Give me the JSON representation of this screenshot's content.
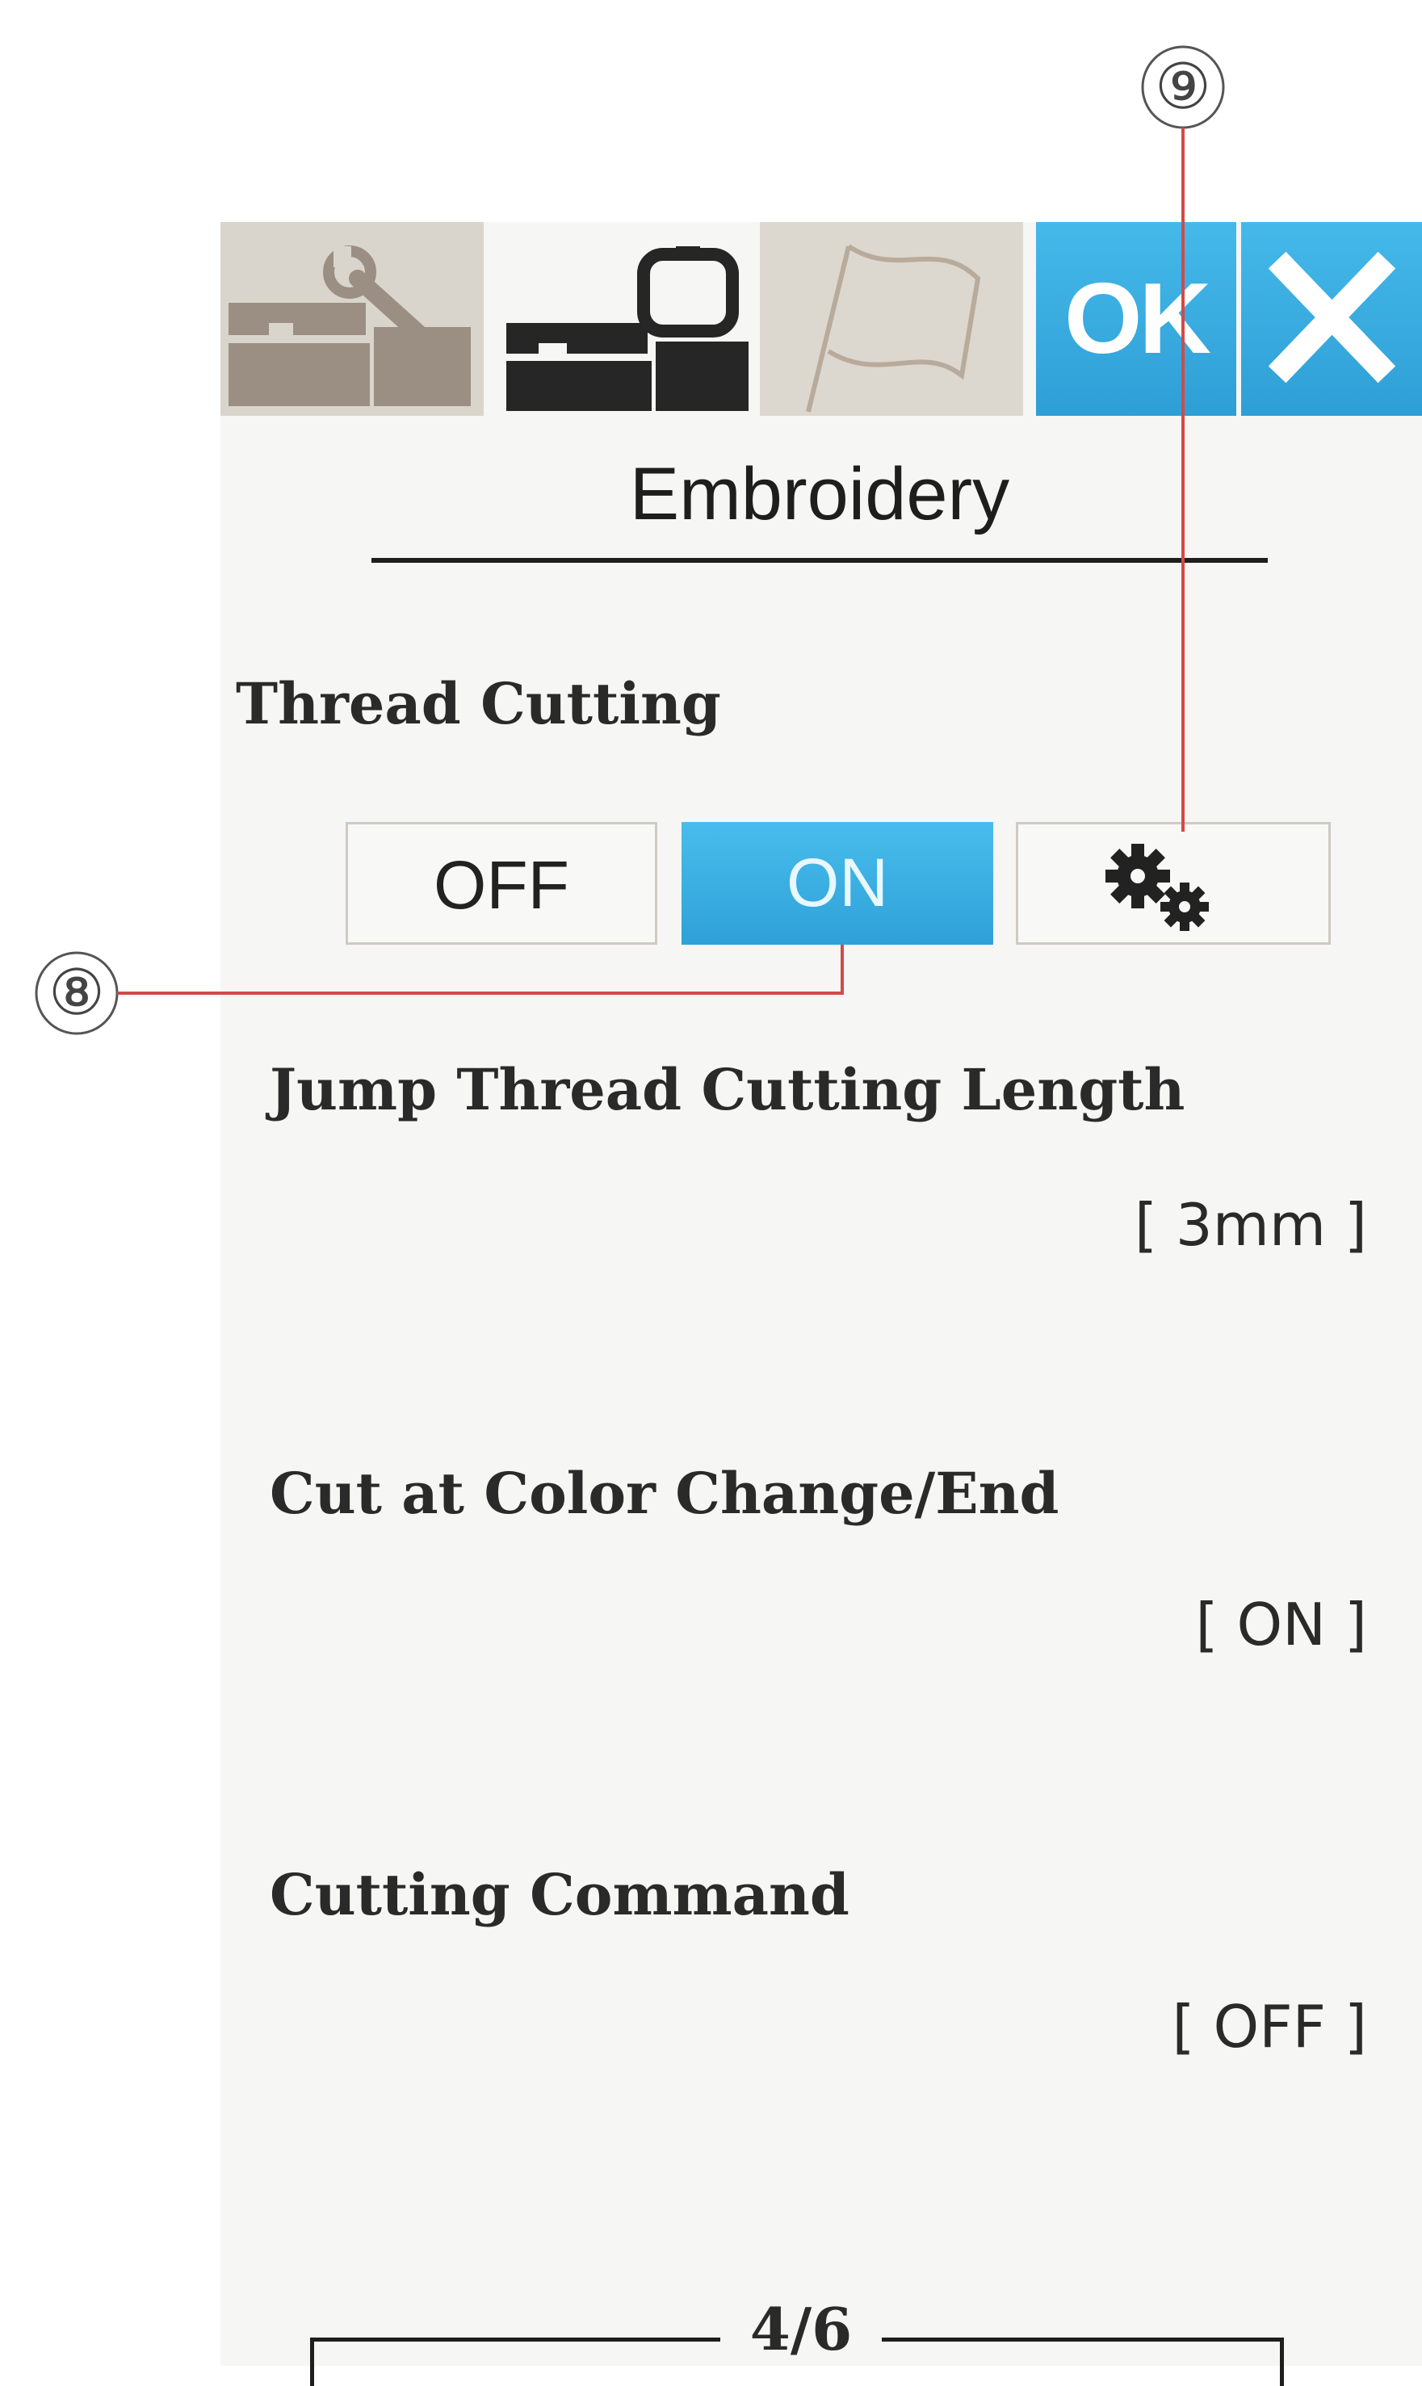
{
  "header": {
    "tabs": [
      {
        "id": "setup",
        "icon": "machine-setup-icon"
      },
      {
        "id": "embroidery",
        "icon": "embroidery-machine-icon"
      },
      {
        "id": "language",
        "icon": "flag-icon"
      }
    ],
    "ok_label": "OK",
    "close_icon": "close-icon"
  },
  "page": {
    "title": "Embroidery",
    "indicator": "4/6"
  },
  "thread_cutting": {
    "label": "Thread Cutting",
    "options": [
      "OFF",
      "ON"
    ],
    "selected": "ON",
    "settings_icon": "gears-icon"
  },
  "settings": [
    {
      "label": "Jump Thread Cutting Length",
      "value": "[ 3mm ]"
    },
    {
      "label": "Cut at Color Change/End",
      "value": "[ ON ]"
    },
    {
      "label": "Cutting Command",
      "value": "[ OFF ]"
    }
  ],
  "callouts": [
    "⑧",
    "⑨"
  ],
  "colors": {
    "accent_blue": "#36aadf",
    "callout_line": "#d24a4a",
    "tab_inactive": "#dbd6cd",
    "screen_background": "#f6f6f4"
  }
}
